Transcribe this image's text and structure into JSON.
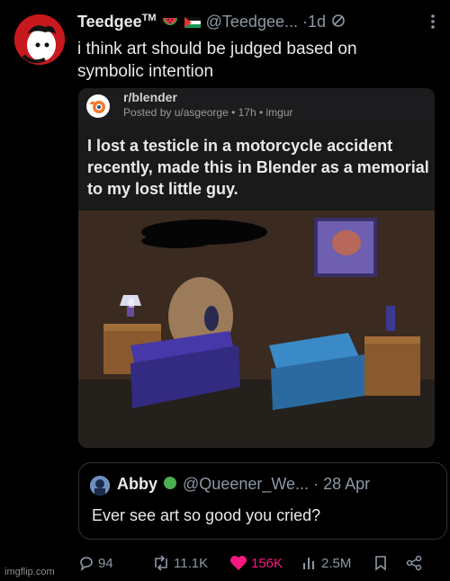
{
  "tweet": {
    "display_name": "Teedgee",
    "tm": "TM",
    "handle": "@Teedgee...",
    "separator": "·",
    "time": "1d",
    "text": "i think art should be judged based on symbolic intention"
  },
  "embedded_reddit": {
    "subreddit": "r/blender",
    "posted_by": "Posted by u/asgeorge • 17h • imgur",
    "title": "I lost a testicle in a motorcycle accident recently, made this in Blender as a memorial to my lost little guy."
  },
  "quoted_tweet": {
    "display_name": "Abby",
    "handle": "@Queener_We...",
    "separator": "·",
    "date": "28 Apr",
    "text": "Ever see art so good you cried?"
  },
  "actions": {
    "replies": "94",
    "retweets": "11.1K",
    "likes": "156K",
    "views": "2.5M"
  },
  "colors": {
    "like": "#f91880",
    "muted": "#8b98a5",
    "text": "#e7e9ea"
  },
  "watermark": "imgflip.com"
}
